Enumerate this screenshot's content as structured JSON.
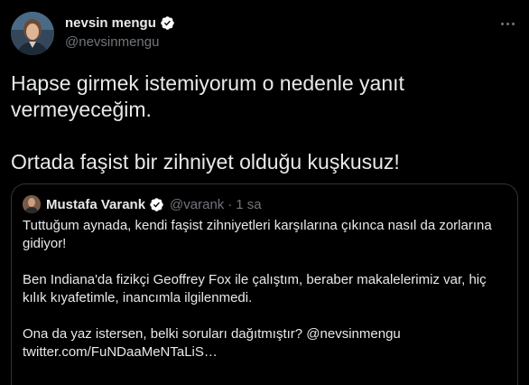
{
  "author": {
    "name": "nevsin mengu",
    "handle": "@nevsinmengu"
  },
  "tweet": {
    "text": "Hapse girmek istemiyorum o nedenle yanıt vermeyeceğim.\n\nOrtada faşist bir zihniyet olduğu kuşkusuz!"
  },
  "quoted": {
    "name": "Mustafa Varank",
    "handle": "@varank",
    "separator": "·",
    "time": "1 sa",
    "text": "Tuttuğum aynada, kendi faşist zihniyetleri karşılarına  çıkınca nasıl da zorlarına gidiyor!\n\nBen Indiana'da fizikçi Geoffrey Fox ile çalıştım, beraber makalelerimiz var, hiç kılık kıyafetimle, inancımla ilgilenmedi.\n\nOna da yaz istersen, belki soruları dağıtmıştır? @nevsinmengu twitter.com/FuNDaaMeNTaLiS…"
  },
  "icons": {
    "verified": "verified-badge-icon",
    "more": "more-options-icon"
  },
  "colors": {
    "background": "#000000",
    "text": "#e7e9ea",
    "secondary": "#71767b",
    "border": "#2f3336",
    "verified_fill": "#ffffff"
  }
}
